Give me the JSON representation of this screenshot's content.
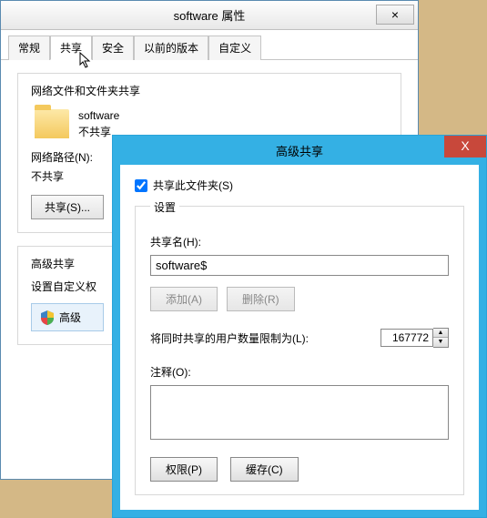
{
  "back": {
    "title": "software 属性",
    "tabs": [
      "常规",
      "共享",
      "安全",
      "以前的版本",
      "自定义"
    ],
    "active_tab": 1,
    "section1_label": "网络文件和文件夹共享",
    "folder_name": "software",
    "folder_status": "不共享",
    "path_label": "网络路径(N):",
    "path_value": "不共享",
    "share_button": "共享(S)...",
    "adv_label": "高级共享",
    "adv_desc": "设置自定义权",
    "adv_button": "高级"
  },
  "front": {
    "title": "高级共享",
    "checkbox_label": "共享此文件夹(S)",
    "checkbox_checked": true,
    "settings_label": "设置",
    "share_name_label": "共享名(H):",
    "share_name_value": "software$",
    "add_button": "添加(A)",
    "remove_button": "删除(R)",
    "limit_label": "将同时共享的用户数量限制为(L):",
    "limit_value": "167772",
    "comment_label": "注释(O):",
    "comment_value": "",
    "perm_button": "权限(P)",
    "cache_button": "缓存(C)"
  }
}
